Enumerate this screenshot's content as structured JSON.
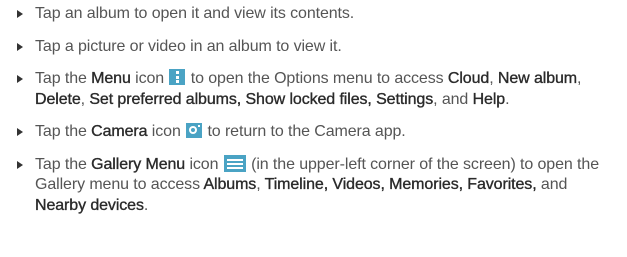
{
  "bullets": {
    "b1": {
      "text": "Tap an album to open it and view its contents."
    },
    "b2": {
      "text": "Tap a picture or video in an album to view it."
    },
    "b3": {
      "t1": "Tap the ",
      "menu": "Menu",
      "t2": " icon ",
      "t3": " to open the Options menu to access ",
      "cloud": "Cloud",
      "t4": ", ",
      "new_album": "New album",
      "t5": ", ",
      "delete": "Delete",
      "t6": ", ",
      "set_preferred": "Set preferred albums,",
      "t7": " ",
      "show_locked": "Show locked files,",
      "t8": " ",
      "settings": "Settings",
      "t9": ", and ",
      "help": "Help",
      "t10": "."
    },
    "b4": {
      "t1": "Tap the ",
      "camera": "Camera",
      "t2": " icon ",
      "t3": " to return to the Camera app."
    },
    "b5": {
      "t1": "Tap the ",
      "gallery_menu": "Gallery Menu",
      "t2": " icon ",
      "t3": " (in the upper-left corner of the screen) to open the Gallery menu to access ",
      "albums": "Albums",
      "t4": ", ",
      "timeline": "Timeline,",
      "t5": " ",
      "videos": "Videos,",
      "t6": " ",
      "memories": "Memories,",
      "t7": " ",
      "favorites": "Favorites,",
      "t8": " and ",
      "nearby": "Nearby devices",
      "t9": "."
    }
  },
  "icons": {
    "menu": "menu-icon",
    "camera": "camera-icon",
    "gallery": "gallery-menu-icon"
  },
  "colors": {
    "icon_accent": "#4aa3c4",
    "body_text": "#555555",
    "emphasis_text": "#2a2a2a"
  }
}
